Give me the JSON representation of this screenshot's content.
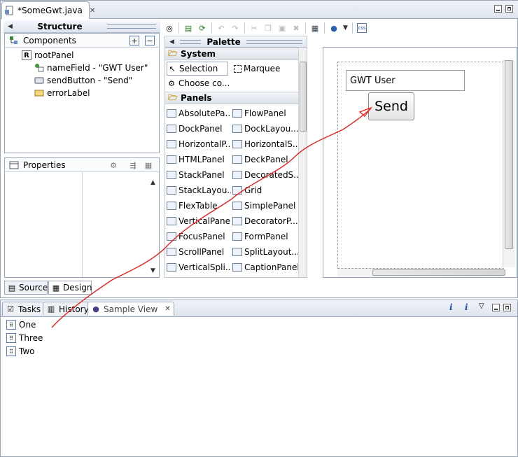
{
  "editor": {
    "tab_title": "*SomeGwt.java",
    "structure": {
      "title": "Structure",
      "components_label": "Components",
      "tree": [
        {
          "label": "rootPanel",
          "icon": "root-panel-icon"
        },
        {
          "label": "nameField - \"GWT User\"",
          "icon": "textbox-icon"
        },
        {
          "label": "sendButton - \"Send\"",
          "icon": "button-icon"
        },
        {
          "label": "errorLabel",
          "icon": "label-icon"
        }
      ],
      "properties_label": "Properties"
    },
    "palette": {
      "title": "Palette",
      "system_label": "System",
      "selection_label": "Selection",
      "marquee_label": "Marquee",
      "choose_label": "Choose co...",
      "panels_label": "Panels",
      "items": [
        [
          "AbsolutePa...",
          "FlowPanel"
        ],
        [
          "DockPanel",
          "DockLayou..."
        ],
        [
          "HorizontalP...",
          "HorizontalS..."
        ],
        [
          "HTMLPanel",
          "DeckPanel"
        ],
        [
          "StackPanel",
          "DecoratedS..."
        ],
        [
          "StackLayou...",
          "Grid"
        ],
        [
          "FlexTable",
          "SimplePanel"
        ],
        [
          "VerticalPanel",
          "DecoratorP..."
        ],
        [
          "FocusPanel",
          "FormPanel"
        ],
        [
          "ScrollPanel",
          "SplitLayout..."
        ],
        [
          "VerticalSpli...",
          "CaptionPanel"
        ]
      ]
    },
    "canvas": {
      "textbox_value": "GWT User",
      "button_label": "Send"
    },
    "bottom_tabs": {
      "source": "Source",
      "design": "Design"
    }
  },
  "views": {
    "tasks": "Tasks",
    "history": "History",
    "sample_view": "Sample View",
    "info_glyph": "i",
    "items": [
      "One",
      "Three",
      "Two"
    ]
  },
  "colors": {
    "accent_line": "#e8241e",
    "frame": "#9aa7b8",
    "header_bg": "#dfe6f0"
  }
}
